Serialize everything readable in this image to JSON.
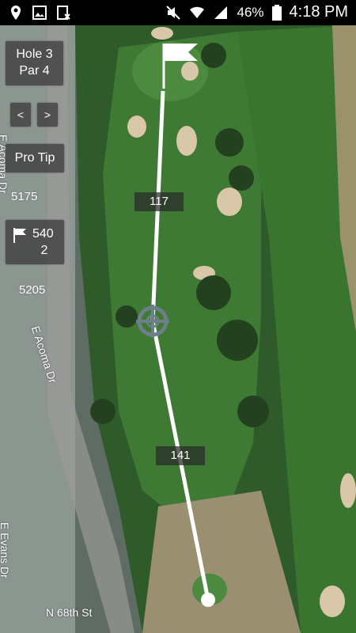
{
  "status_bar": {
    "icons": [
      "location-icon",
      "image-icon",
      "screenshot-icon",
      "mute-icon",
      "wifi-icon",
      "signal-icon",
      "battery-icon"
    ],
    "battery": "46%",
    "time": "4:18 PM"
  },
  "hole_panel": {
    "hole": "Hole 3",
    "par": "Par 4",
    "prev": "<",
    "next": ">",
    "pro_tip": "Pro Tip",
    "distance_top": "5175",
    "flag_distance_line1": "540",
    "flag_distance_line2": "2",
    "distance_bottom": "5205"
  },
  "map": {
    "yardage_to_pin": "117",
    "yardage_from_tee": "141",
    "streets": [
      "E Acoma Dr",
      "E Acoma Dr",
      "E Evans Dr",
      "N 68th St"
    ]
  },
  "colors": {
    "fairway": "#3f7a34",
    "rough": "#2f5a2a",
    "line": "#ffffff"
  }
}
